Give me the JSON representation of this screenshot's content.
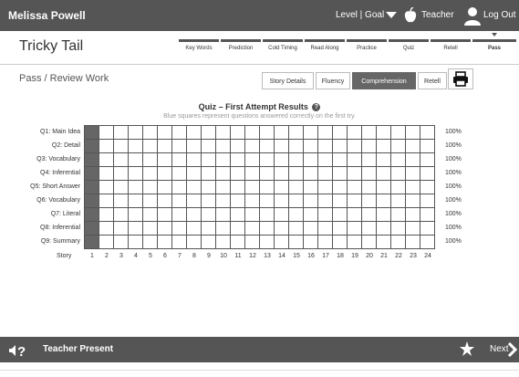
{
  "topbar": {
    "user_name": "Melissa Powell",
    "level_goal": "Level | Goal",
    "teacher_label": "Teacher",
    "logout_label": "Log Out"
  },
  "header": {
    "title": "Tricky Tail",
    "steps": [
      {
        "label": "Key Words"
      },
      {
        "label": "Prediction"
      },
      {
        "label": "Cold Timing"
      },
      {
        "label": "Read Along"
      },
      {
        "label": "Practice"
      },
      {
        "label": "Quiz"
      },
      {
        "label": "Retell"
      },
      {
        "label": "Pass",
        "current": true
      }
    ]
  },
  "subheader": {
    "title": "Pass / Review Work",
    "tabs": [
      {
        "label": "Story Details",
        "active": false
      },
      {
        "label": "Fluency",
        "active": false
      },
      {
        "label": "Comprehension",
        "active": true
      },
      {
        "label": "Retell",
        "active": false
      }
    ],
    "print_icon": "printer-icon"
  },
  "quiz": {
    "title": "Quiz – First Attempt Results",
    "help_icon": "?",
    "subtitle": "Blue squares represent questions answered correctly on the first try.",
    "story_label": "Story",
    "story_numbers": [
      "1",
      "2",
      "3",
      "4",
      "5",
      "6",
      "7",
      "8",
      "9",
      "10",
      "11",
      "12",
      "13",
      "14",
      "15",
      "16",
      "17",
      "18",
      "19",
      "20",
      "21",
      "22",
      "23",
      "24"
    ],
    "rows": [
      {
        "label": "Q1: Main Idea",
        "percent": "100%"
      },
      {
        "label": "Q2: Detail",
        "percent": "100%"
      },
      {
        "label": "Q3: Vocabulary",
        "percent": "100%"
      },
      {
        "label": "Q4: Inferential",
        "percent": "100%"
      },
      {
        "label": "Q5: Short Answer",
        "percent": "100%"
      },
      {
        "label": "Q6: Vocabulary",
        "percent": "100%"
      },
      {
        "label": "Q7: Literal",
        "percent": "100%"
      },
      {
        "label": "Q8: Inferential",
        "percent": "100%"
      },
      {
        "label": "Q9: Summary",
        "percent": "100%"
      }
    ],
    "filled_story_column": 1
  },
  "footer": {
    "teacher_present": "Teacher Present",
    "next_label": "Next"
  },
  "colors": {
    "bar_bg": "#555555",
    "active_tab": "#666666",
    "filled_cell": "#666666"
  }
}
